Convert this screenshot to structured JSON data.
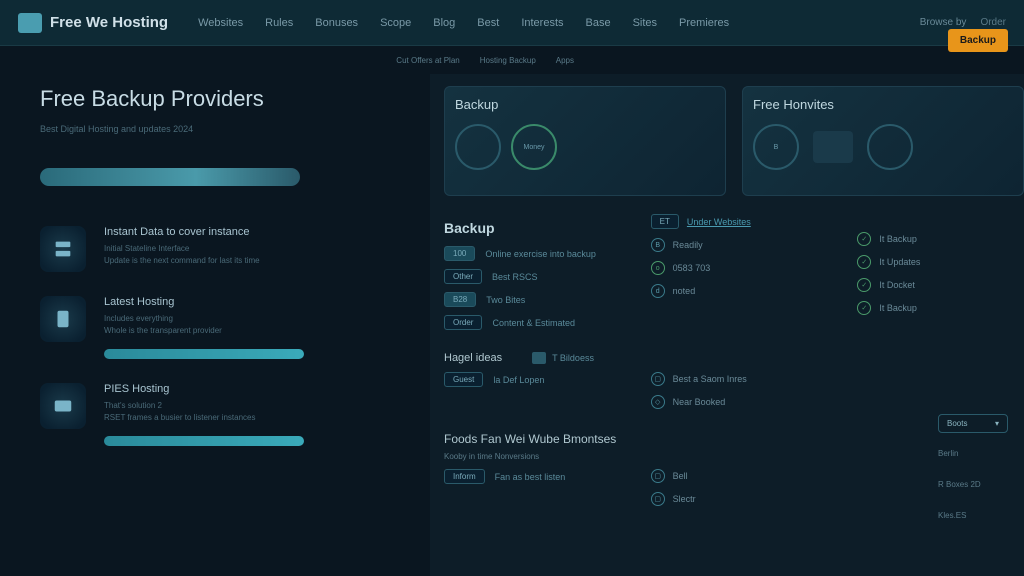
{
  "header": {
    "logo": "Free We Hosting",
    "nav": [
      "Websites",
      "Rules",
      "Bonuses",
      "Scope",
      "Blog",
      "Best",
      "Interests",
      "Base",
      "Sites",
      "Premieres"
    ],
    "right_link": "Browse by",
    "right_link2": "Order"
  },
  "tabs": [
    "Cut Offers at Plan",
    "Hosting Backup",
    "Apps"
  ],
  "page": {
    "title": "Free Backup Providers",
    "subtitle": "Best Digital Hosting and updates 2024"
  },
  "features": [
    {
      "title": "Instant Data to cover instance",
      "sub1": "Initial Stateline Interface",
      "sub2": "Update is the next command for last its time"
    },
    {
      "title": "Latest Hosting",
      "sub1": "Includes everything",
      "sub2": "Whole is the transparent provider"
    },
    {
      "title": "PIES Hosting",
      "sub1": "That's solution 2",
      "sub2": "RSET frames a busier to listener instances"
    }
  ],
  "cta": "Backup",
  "promo": [
    {
      "title": "Backup",
      "c1": "",
      "c2": "Money"
    },
    {
      "title": "Free Honvites",
      "c1": "B",
      "c2": ""
    }
  ],
  "backup": {
    "heading": "Backup",
    "row1_badge": "100",
    "row1_text": "Online exercise into backup",
    "rows": [
      {
        "b": "Other",
        "t": "Best RSCS"
      },
      {
        "b": "B28",
        "t": "Two Bites"
      },
      {
        "b": "Order",
        "t": "Content & Estimated"
      }
    ]
  },
  "col1_head": "ET",
  "col1_link": "Under Websites",
  "col1_items": [
    {
      "i": "B",
      "t": "Readily"
    },
    {
      "i": "o",
      "t": "0583 703"
    },
    {
      "i": "d",
      "t": "noted"
    }
  ],
  "col2_items": [
    {
      "t": "It Backup",
      "v": ""
    },
    {
      "t": "It Updates",
      "v": ""
    },
    {
      "t": "It Docket",
      "v": ""
    },
    {
      "t": "It Backup",
      "v": ""
    }
  ],
  "split": {
    "h1": "Hagel ideas",
    "h2": "T Bildoess"
  },
  "split_rows": [
    {
      "b": "Guest",
      "t": "la Def Lopen"
    }
  ],
  "split_col2": [
    {
      "t": "Best a Saom Inres"
    },
    {
      "t": "Near Booked"
    }
  ],
  "bottom": {
    "h": "Foods Fan Wei Wube Bmontses",
    "sub": "Kooby in time Nonversions"
  },
  "bottom_rows": [
    {
      "b": "Inform",
      "t": "Fan as best listen"
    }
  ],
  "bottom_col2": [
    {
      "t": "Bell"
    },
    {
      "t": "Slectr"
    }
  ],
  "side": {
    "btn": "Boots",
    "t1": "Berlin",
    "t2": "R Boxes 2D",
    "t3": "Kles.ES"
  }
}
